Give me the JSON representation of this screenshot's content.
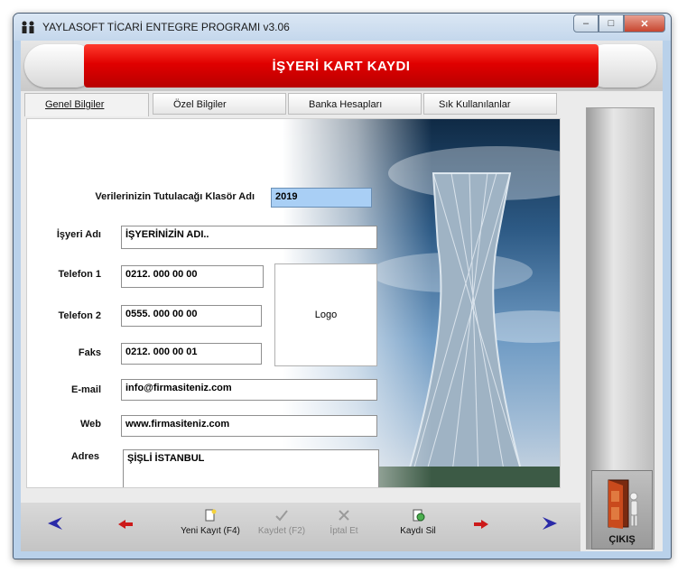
{
  "window": {
    "title": "YAYLASOFT TİCARİ ENTEGRE PROGRAMI v3.06"
  },
  "header": {
    "title": "İŞYERİ KART KAYDI"
  },
  "tabs": [
    {
      "label": "Genel Bilgiler",
      "active": true
    },
    {
      "label": "Özel Bilgiler",
      "active": false
    },
    {
      "label": "Banka Hesapları",
      "active": false
    },
    {
      "label": "Sık Kullanılanlar",
      "active": false
    }
  ],
  "form": {
    "folder_label": "Verilerinizin Tutulacağı Klasör Adı",
    "folder_value": "2019",
    "company_label": "İşyeri Adı",
    "company_value": "İŞYERİNİZİN ADI..",
    "phone1_label": "Telefon 1",
    "phone1_value": "0212. 000 00 00",
    "phone2_label": "Telefon 2",
    "phone2_value": "0555. 000 00 00",
    "fax_label": "Faks",
    "fax_value": "0212. 000 00 01",
    "email_label": "E-mail",
    "email_value": "info@firmasiteniz.com",
    "web_label": "Web",
    "web_value": "www.firmasiteniz.com",
    "address_label": "Adres",
    "address_value": "ŞİŞLİ İSTANBUL",
    "logo_label": "Logo"
  },
  "toolbar": {
    "new_label": "Yeni Kayıt (F4)",
    "save_label": "Kaydet (F2)",
    "cancel_label": "İptal Et",
    "delete_label": "Kaydı Sil"
  },
  "exit": {
    "label": "ÇIKIŞ"
  },
  "colors": {
    "header_red": "#e00000",
    "accent_blue": "#a9cff5",
    "nav_blue": "#2a2aa8",
    "nav_red": "#cc1a1a"
  }
}
